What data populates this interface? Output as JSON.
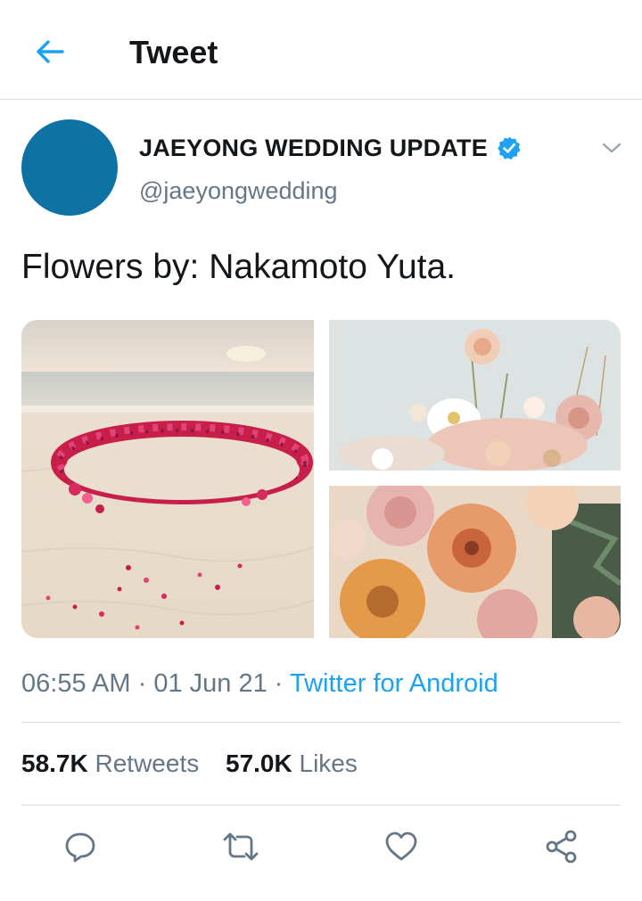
{
  "header": {
    "title": "Tweet",
    "back_icon": "arrow-left-icon"
  },
  "tweet": {
    "author": {
      "display_name": "JAEYONG WEDDING UPDATE",
      "handle": "@jaeyongwedding",
      "verified": true,
      "avatar_color": "#0e73a4"
    },
    "text": "Flowers by: Nakamoto Yuta.",
    "media": [
      {
        "icon": "photo-beach-flower-circle"
      },
      {
        "icon": "photo-pastel-flower-arrangement"
      },
      {
        "icon": "photo-peach-rose-bouquet"
      }
    ],
    "meta": {
      "time": "06:55 AM",
      "separator": "·",
      "date": "01 Jun 21",
      "source": "Twitter for Android"
    },
    "stats": {
      "retweets_count": "58.7K",
      "retweets_label": "Retweets",
      "likes_count": "57.0K",
      "likes_label": "Likes"
    },
    "actions": [
      {
        "icon": "reply-icon"
      },
      {
        "icon": "retweet-icon"
      },
      {
        "icon": "like-icon"
      },
      {
        "icon": "share-icon"
      }
    ]
  },
  "colors": {
    "accent": "#1da1f2",
    "text_primary": "#14171a",
    "text_secondary": "#657786",
    "divider": "#d6dde3"
  }
}
